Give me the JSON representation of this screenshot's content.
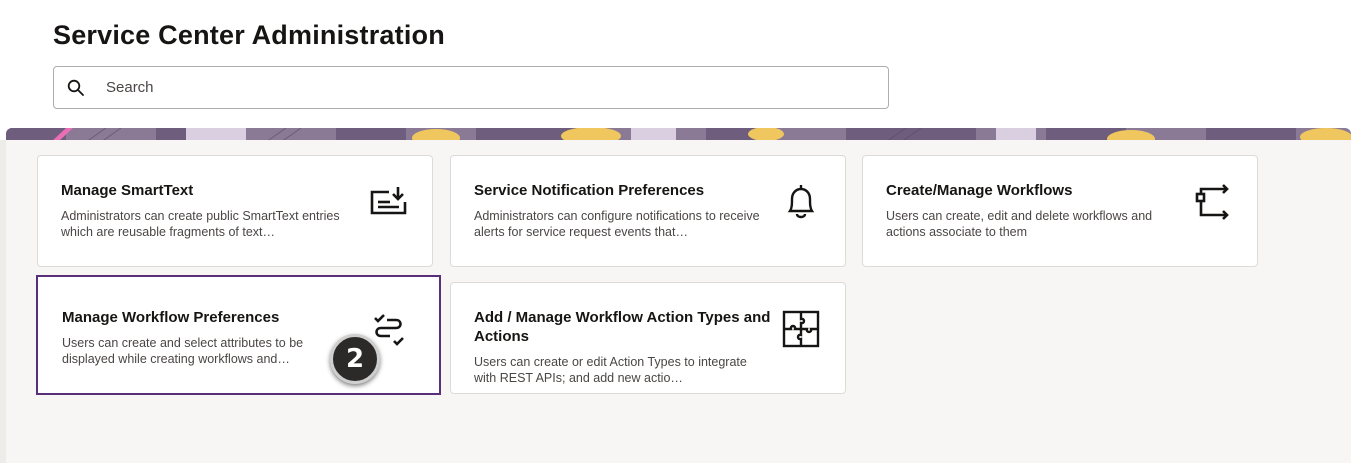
{
  "header": {
    "title": "Service Center Administration"
  },
  "search": {
    "placeholder": "Search",
    "value": ""
  },
  "cards": [
    {
      "title": "Manage SmartText",
      "description": "Administrators can create public SmartText entries which are reusable fragments of text…",
      "icon": "smarttext-download-icon"
    },
    {
      "title": "Service Notification Preferences",
      "description": "Administrators can configure notifications to receive alerts for service request events that…",
      "icon": "bell-icon"
    },
    {
      "title": "Create/Manage Workflows",
      "description": "Users can create, edit and delete workflows and actions associate to them",
      "icon": "workflow-arrows-icon"
    },
    {
      "title": "Manage Workflow Preferences",
      "description": "Users can create and select attributes to be displayed while creating workflows and…",
      "icon": "workflow-check-icon"
    },
    {
      "title": "Add / Manage Workflow Action Types and Actions",
      "description": "Users can create or edit Action Types to integrate with REST APIs; and add new actio…",
      "icon": "puzzle-icon"
    }
  ],
  "step_badge": "2",
  "colors": {
    "selection_border": "#5a2f7a",
    "badge_bg": "#2b2a29",
    "content_bg": "#f7f6f4"
  }
}
